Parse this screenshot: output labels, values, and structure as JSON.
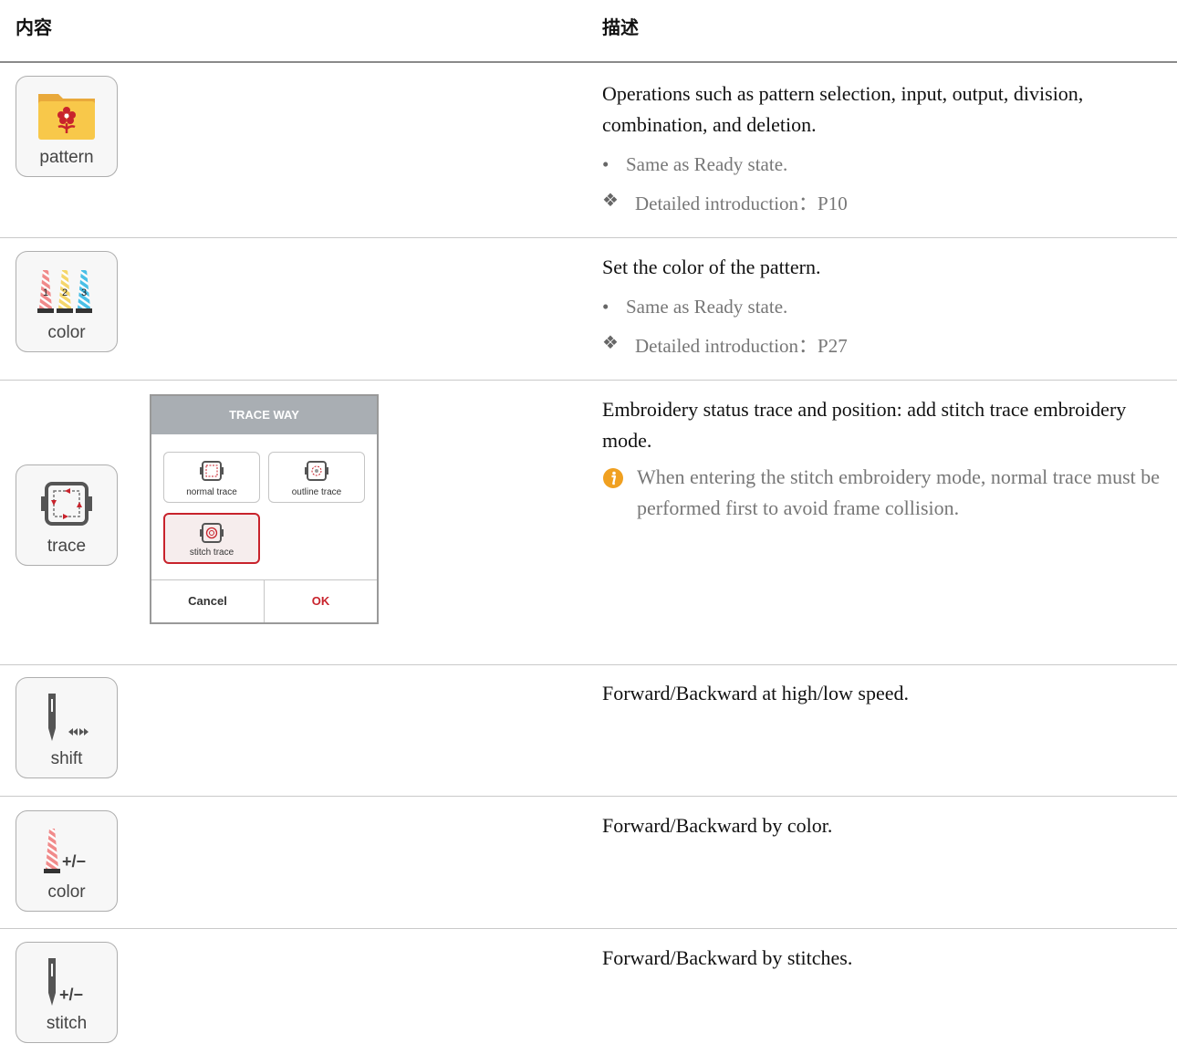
{
  "header": {
    "col_content": "内容",
    "col_desc": "描述"
  },
  "rows": [
    {
      "button": {
        "label": "pattern",
        "icon": "pattern-folder-icon"
      },
      "main": "Operations such as pattern selection, input, output, division, combination, and deletion.",
      "bullet": "Same as Ready state.",
      "ref": "Detailed introduction：P10"
    },
    {
      "button": {
        "label": "color",
        "icon": "thread-spools-icon"
      },
      "main": "Set the color of the pattern.",
      "bullet": "Same as Ready state.",
      "ref": "Detailed introduction：P27"
    },
    {
      "button": {
        "label": "trace",
        "icon": "frame-trace-icon"
      },
      "main": "Embroidery status trace and position: add stitch trace embroidery mode.",
      "note": "When entering the stitch embroidery mode, normal trace must be performed first to avoid frame collision."
    },
    {
      "button": {
        "label": "shift",
        "icon": "needle-shift-icon"
      },
      "main": "Forward/Backward at high/low speed."
    },
    {
      "button": {
        "label": "color",
        "icon": "spool-plus-minus-icon"
      },
      "main": "Forward/Backward by color."
    },
    {
      "button": {
        "label": "stitch",
        "icon": "needle-plus-minus-icon"
      },
      "main": "Forward/Backward by stitches."
    }
  ],
  "dialog": {
    "title": "TRACE WAY",
    "options": [
      "normal trace",
      "outline trace",
      "stitch trace"
    ],
    "selected": "stitch trace",
    "cancel": "Cancel",
    "ok": "OK"
  },
  "glyphs": {
    "plus_minus": "+/−",
    "spool_numbers": [
      "1",
      "2",
      "3"
    ]
  },
  "colors": {
    "accent_red": "#c8232c",
    "note_orange": "#f0a020",
    "folder_yellow": "#f8c84a"
  }
}
